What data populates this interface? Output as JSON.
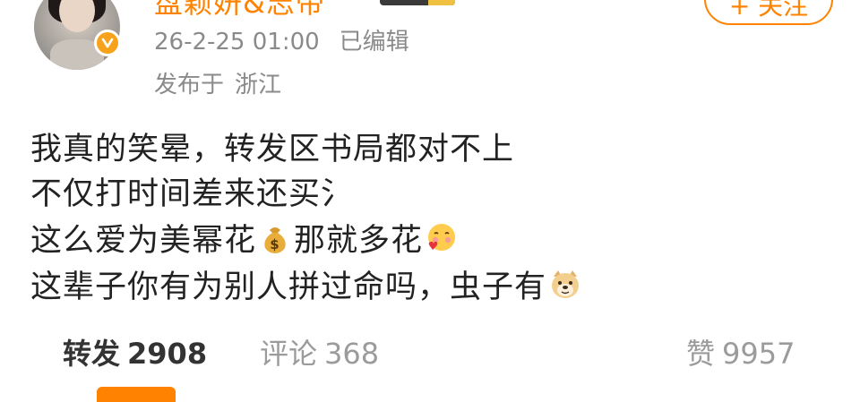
{
  "header": {
    "username": "盘颖妍&志帝",
    "follow_label": "+ 关注",
    "timestamp": "26-2-25 01:00",
    "edited_label": "已编辑",
    "location_prefix": "发布于",
    "location": "浙江"
  },
  "post": {
    "lines": [
      {
        "text": "我真的笑晕，转发区书局都对不上"
      },
      {
        "text": "不仅打时间差来还买氵"
      },
      {
        "text_a": "这么爱为美幂花",
        "emoji_a": "money-bag-icon",
        "text_b": "那就多花",
        "emoji_b": "blush-heart-face-icon"
      },
      {
        "text": "这辈子你有为别人拼过命吗，虫子有",
        "emoji": "doge-icon"
      }
    ]
  },
  "stats": {
    "repost_label": "转发",
    "repost_count": "2908",
    "comment_label": "评论",
    "comment_count": "368",
    "like_label": "赞",
    "like_count": "9957"
  },
  "colors": {
    "accent": "#ff8200",
    "meta": "#8a8a8a",
    "text": "#222222"
  }
}
